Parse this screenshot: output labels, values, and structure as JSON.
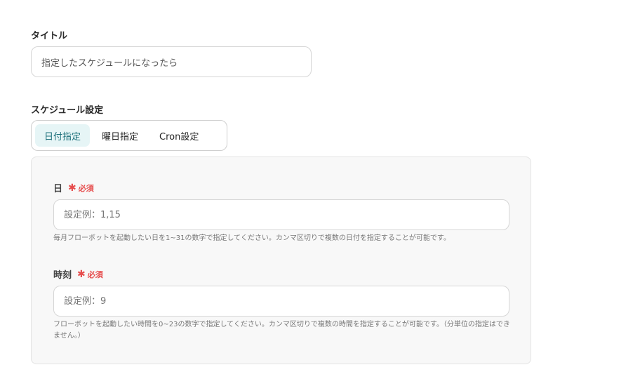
{
  "title_field": {
    "label": "タイトル",
    "value": "指定したスケジュールになったら"
  },
  "schedule": {
    "label": "スケジュール設定",
    "tabs": [
      {
        "label": "日付指定",
        "active": true
      },
      {
        "label": "曜日指定",
        "active": false
      },
      {
        "label": "Cron設定",
        "active": false
      }
    ]
  },
  "day_field": {
    "label": "日",
    "required_star": "✱",
    "required_text": "必須",
    "placeholder": "設定例：1,15",
    "help": "毎月フローボットを起動したい日を1~31の数字で指定してください。カンマ区切りで複数の日付を指定することが可能です。"
  },
  "time_field": {
    "label": "時刻",
    "required_star": "✱",
    "required_text": "必須",
    "placeholder": "設定例：9",
    "help": "フローボットを起動したい時間を0~23の数字で指定してください。カンマ区切りで複数の時間を指定することが可能です。（分単位の指定はできません。）"
  },
  "colors": {
    "accent": "#1b6f7a",
    "accent_bg": "#e6f5f6",
    "required": "#e64c4c"
  }
}
